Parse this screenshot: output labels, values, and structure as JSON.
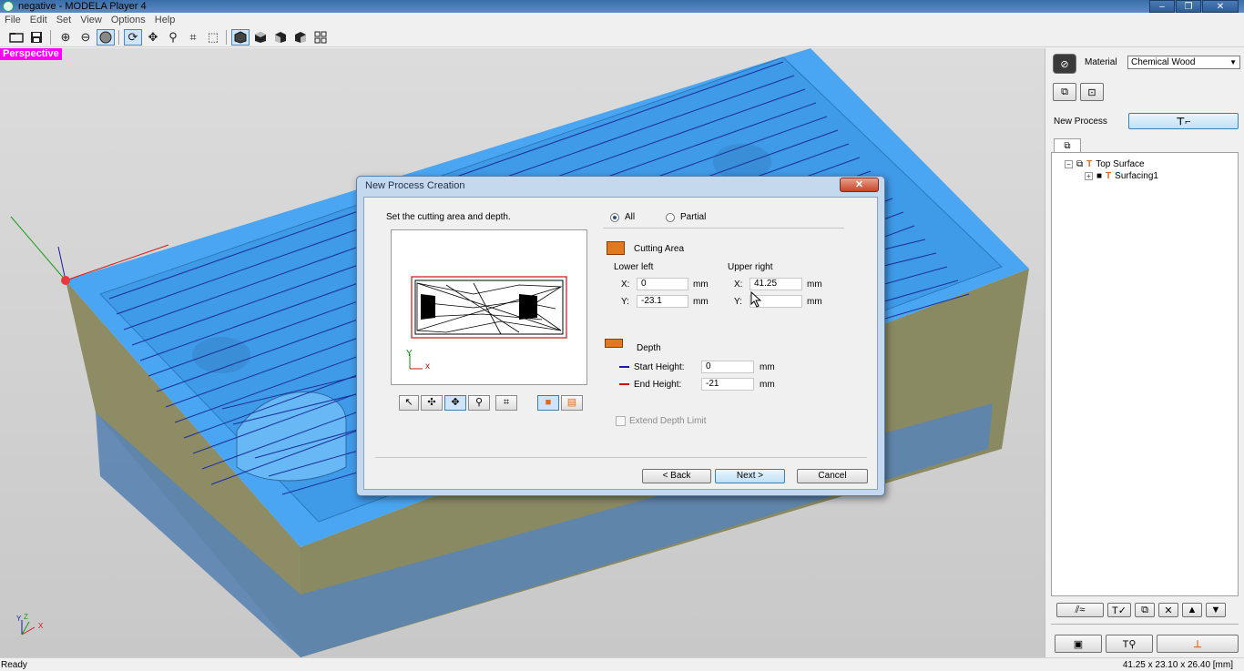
{
  "window": {
    "title": "negative - MODELA Player 4",
    "controls": [
      "–",
      "❐",
      "✕"
    ]
  },
  "menu": [
    "File",
    "Edit",
    "Set",
    "View",
    "Options",
    "Help"
  ],
  "toolbar": {
    "icons": [
      "new-file-icon",
      "save-icon",
      "globe-wire-icon",
      "globe-icon",
      "sphere-solid-icon",
      "rotate-icon",
      "pan-icon",
      "zoom-icon",
      "fit-icon",
      "zoom-window-icon",
      "view-iso-icon",
      "view-top-icon",
      "view-front-icon",
      "view-side-icon",
      "view-multi-icon"
    ]
  },
  "viewport": {
    "view_label": "Perspective",
    "axis": {
      "x": "X",
      "y": "Y",
      "z": "Z"
    }
  },
  "right_panel": {
    "material_label": "Material",
    "material_value": "Chemical Wood",
    "new_process_label": "New Process",
    "tree": [
      {
        "label": "Top Surface",
        "level": 0
      },
      {
        "label": "Surfacing1",
        "level": 1
      }
    ]
  },
  "status": {
    "left": "Ready",
    "right": "41.25 x 23.10 x 26.40 [mm]"
  },
  "dialog": {
    "title": "New Process Creation",
    "close": "✕",
    "instruction": "Set the cutting area and depth.",
    "area_mode": {
      "all": "All",
      "partial": "Partial",
      "selected": "All"
    },
    "cutting_area": {
      "heading": "Cutting Area",
      "lower_left": "Lower left",
      "upper_right": "Upper right",
      "x_label": "X:",
      "y_label": "Y:",
      "unit": "mm",
      "lower_left_x": "0",
      "lower_left_y": "-23.1",
      "upper_right_x": "41.25",
      "upper_right_y": ""
    },
    "depth": {
      "heading": "Depth",
      "start_label": "Start Height:",
      "start_value": "0",
      "end_label": "End Height:",
      "end_value": "-21",
      "unit": "mm"
    },
    "extend_depth_limit": "Extend Depth Limit",
    "preview_axes": {
      "y": "Y",
      "x": "x"
    },
    "buttons": {
      "back": "< Back",
      "next": "Next >",
      "cancel": "Cancel"
    }
  },
  "colors": {
    "model_top": "#4aa6f2",
    "model_side": "#8a8a64",
    "model_bottom": "#5a84b2",
    "perspective_label": "#ff00ff"
  }
}
